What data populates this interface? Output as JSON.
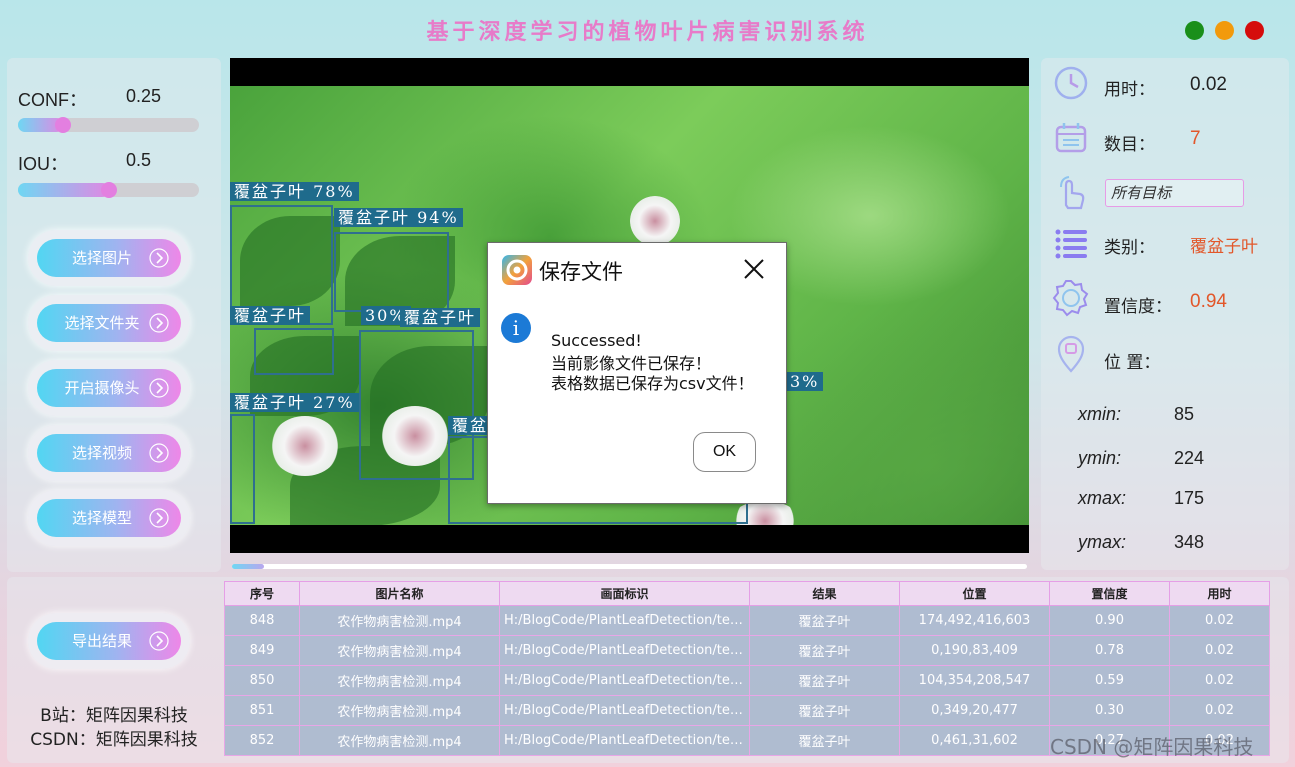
{
  "window": {
    "title": "基于深度学习的植物叶片病害识别系统",
    "controls": [
      "minimize-icon",
      "maximize-icon",
      "close-icon"
    ],
    "control_colors": [
      "#1a8f1a",
      "#f29a0c",
      "#d50c0c"
    ]
  },
  "sliders": {
    "conf": {
      "label": "CONF：",
      "value": "0.25",
      "fraction": 0.25
    },
    "iou": {
      "label": "IOU：",
      "value": "0.5",
      "fraction": 0.5
    }
  },
  "left_buttons": [
    {
      "label": "选择图片"
    },
    {
      "label": "选择文件夹"
    },
    {
      "label": "开启摄像头"
    },
    {
      "label": "选择视频"
    },
    {
      "label": "选择模型"
    }
  ],
  "export_button": {
    "label": "导出结果"
  },
  "credits": {
    "bilibili": "B站：矩阵因果科技",
    "csdn": "CSDN：矩阵因果科技"
  },
  "detections": [
    {
      "label": "覆盆子叶  78%"
    },
    {
      "label": "覆盆子叶  94%"
    },
    {
      "label": "覆盆子叶"
    },
    {
      "label": "30%"
    },
    {
      "label": "覆盆子叶"
    },
    {
      "label": "覆盆子叶  27%"
    },
    {
      "label": "覆盆"
    },
    {
      "label": "3%"
    }
  ],
  "video": {
    "progress": 0.04
  },
  "info": {
    "time_label": "用时：",
    "time_value": "0.02",
    "count_label": "数目：",
    "count_value": "7",
    "target_select": "所有目标",
    "class_label": "类别：",
    "class_value": "覆盆子叶",
    "conf_label": "置信度：",
    "conf_value": "0.94",
    "position_label": "位 置：",
    "xmin_label": "xmin:",
    "xmin_value": "85",
    "ymin_label": "ymin:",
    "ymin_value": "224",
    "xmax_label": "xmax:",
    "xmax_value": "175",
    "ymax_label": "ymax:",
    "ymax_value": "348",
    "accent_color": "#e2572a"
  },
  "dialog": {
    "title": "保存文件",
    "line1": "Successed!",
    "line2": "当前影像文件已保存！",
    "line3": "表格数据已保存为csv文件！",
    "ok_label": "OK",
    "icon": "info-icon"
  },
  "table": {
    "headers": [
      "序号",
      "图片名称",
      "画面标识",
      "结果",
      "位置",
      "置信度",
      "用时"
    ],
    "rows": [
      [
        "848",
        "农作物病害检测.mp4",
        "H:/BlogCode/PlantLeafDetection/test...",
        "覆盆子叶",
        "174,492,416,603",
        "0.90",
        "0.02"
      ],
      [
        "849",
        "农作物病害检测.mp4",
        "H:/BlogCode/PlantLeafDetection/test...",
        "覆盆子叶",
        "0,190,83,409",
        "0.78",
        "0.02"
      ],
      [
        "850",
        "农作物病害检测.mp4",
        "H:/BlogCode/PlantLeafDetection/test...",
        "覆盆子叶",
        "104,354,208,547",
        "0.59",
        "0.02"
      ],
      [
        "851",
        "农作物病害检测.mp4",
        "H:/BlogCode/PlantLeafDetection/test...",
        "覆盆子叶",
        "0,349,20,477",
        "0.30",
        "0.02"
      ],
      [
        "852",
        "农作物病害检测.mp4",
        "H:/BlogCode/PlantLeafDetection/test...",
        "覆盆子叶",
        "0,461,31,602",
        "0.27",
        "0.02"
      ]
    ]
  },
  "watermark": "CSDN @矩阵因果科技"
}
